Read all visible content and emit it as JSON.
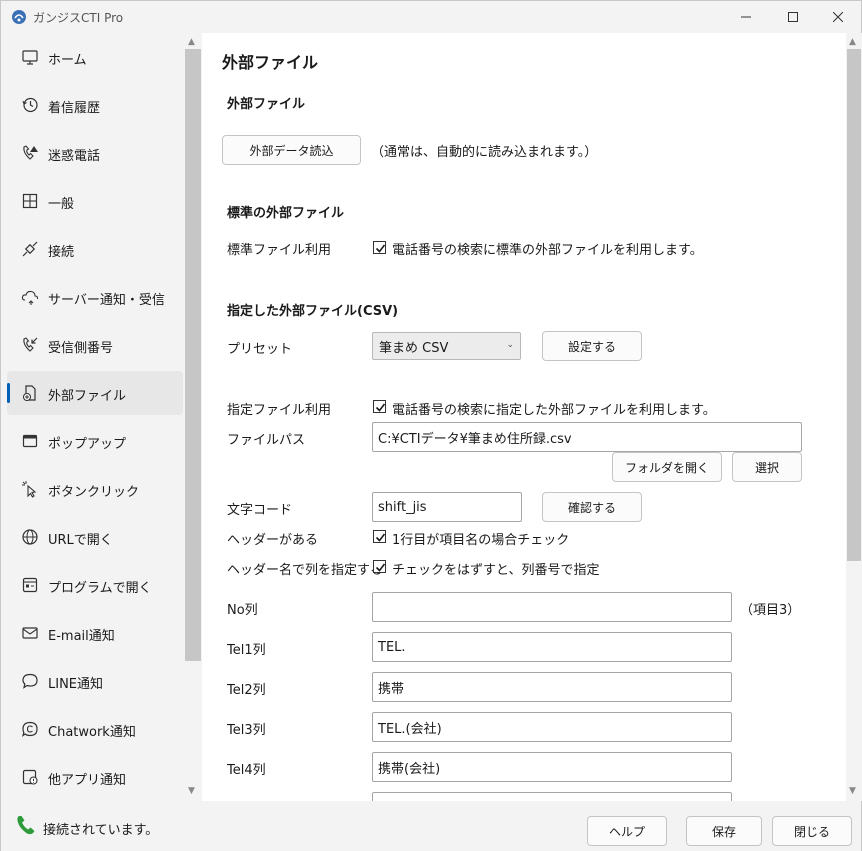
{
  "window": {
    "title": "ガンジスCTI Pro"
  },
  "sidebar": {
    "items": [
      {
        "label": "ホーム",
        "icon": "monitor-icon"
      },
      {
        "label": "着信履歴",
        "icon": "history-icon"
      },
      {
        "label": "迷惑電話",
        "icon": "phone-warning-icon"
      },
      {
        "label": "一般",
        "icon": "grid-icon"
      },
      {
        "label": "接続",
        "icon": "plug-icon"
      },
      {
        "label": "サーバー通知・受信",
        "icon": "cloud-sync-icon"
      },
      {
        "label": "受信側番号",
        "icon": "incoming-call-icon"
      },
      {
        "label": "外部ファイル",
        "icon": "file-import-icon"
      },
      {
        "label": "ポップアップ",
        "icon": "window-icon"
      },
      {
        "label": "ボタンクリック",
        "icon": "cursor-click-icon"
      },
      {
        "label": "URLで開く",
        "icon": "globe-icon"
      },
      {
        "label": "プログラムで開く",
        "icon": "program-icon"
      },
      {
        "label": "E-mail通知",
        "icon": "mail-icon"
      },
      {
        "label": "LINE通知",
        "icon": "chat-bubble-icon"
      },
      {
        "label": "Chatwork通知",
        "icon": "chatwork-icon"
      },
      {
        "label": "他アプリ通知",
        "icon": "app-notify-icon"
      }
    ],
    "active_index": 7
  },
  "main": {
    "page_title": "外部ファイル",
    "section_external": "外部ファイル",
    "load_button": "外部データ読込",
    "load_note": "（通常は、自動的に読み込まれます。）",
    "section_standard": "標準の外部ファイル",
    "standard_label": "標準ファイル利用",
    "standard_check_label": "電話番号の検索に標準の外部ファイルを利用します。",
    "standard_checked": true,
    "section_csv": "指定した外部ファイル(CSV)",
    "preset_label": "プリセット",
    "preset_value": "筆まめ CSV",
    "preset_button": "設定する",
    "specified_label": "指定ファイル利用",
    "specified_check_label": "電話番号の検索に指定した外部ファイルを利用します。",
    "specified_checked": true,
    "filepath_label": "ファイルパス",
    "filepath_value": "C:¥CTIデータ¥筆まめ住所録.csv",
    "open_folder_button": "フォルダを開く",
    "select_button": "選択",
    "charset_label": "文字コード",
    "charset_value": "shift_jis",
    "confirm_button": "確認する",
    "header_label": "ヘッダーがある",
    "header_check_label": "1行目が項目名の場合チェック",
    "header_checked": true,
    "header_col_label": "ヘッダー名で列を指定する",
    "header_col_check_label": "チェックをはずすと、列番号で指定",
    "header_col_checked": true,
    "columns": [
      {
        "label": "No列",
        "value": "",
        "note": "（項目3）"
      },
      {
        "label": "Tel1列",
        "value": "TEL."
      },
      {
        "label": "Tel2列",
        "value": "携帯"
      },
      {
        "label": "Tel3列",
        "value": "TEL.(会社)"
      },
      {
        "label": "Tel4列",
        "value": "携帯(会社)"
      }
    ]
  },
  "footer": {
    "status": "接続されています。",
    "help_button": "ヘルプ",
    "save_button": "保存",
    "close_button": "閉じる"
  },
  "colors": {
    "accent": "#005fb8",
    "status_green": "#2e9b3a"
  }
}
